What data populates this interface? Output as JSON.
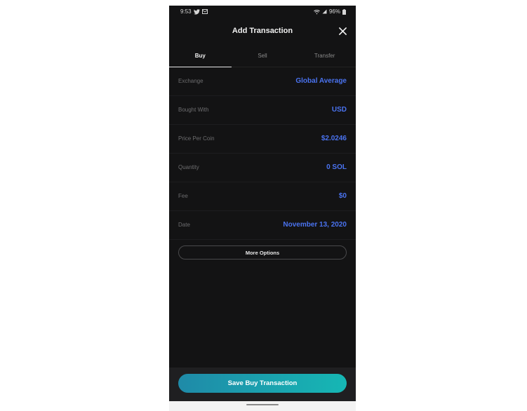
{
  "status_bar": {
    "time": "9:53",
    "battery": "96%",
    "icons": [
      "twitter-icon",
      "mail-icon",
      "wifi-icon",
      "signal-icon",
      "battery-icon"
    ]
  },
  "header": {
    "title": "Add Transaction",
    "close_icon": "close-icon"
  },
  "tabs": [
    {
      "label": "Buy",
      "active": true
    },
    {
      "label": "Sell",
      "active": false
    },
    {
      "label": "Transfer",
      "active": false
    }
  ],
  "rows": [
    {
      "label": "Exchange",
      "value": "Global Average"
    },
    {
      "label": "Bought With",
      "value": "USD"
    },
    {
      "label": "Price Per Coin",
      "value": "$2.0246"
    },
    {
      "label": "Quantity",
      "value": "0 SOL"
    },
    {
      "label": "Fee",
      "value": "$0"
    },
    {
      "label": "Date",
      "value": "November 13, 2020"
    }
  ],
  "more_options_label": "More Options",
  "save_button_label": "Save Buy Transaction",
  "colors": {
    "background": "#131314",
    "accent_value": "#4a73f0",
    "button_gradient_start": "#1f8aa8",
    "button_gradient_end": "#16b7b4"
  }
}
